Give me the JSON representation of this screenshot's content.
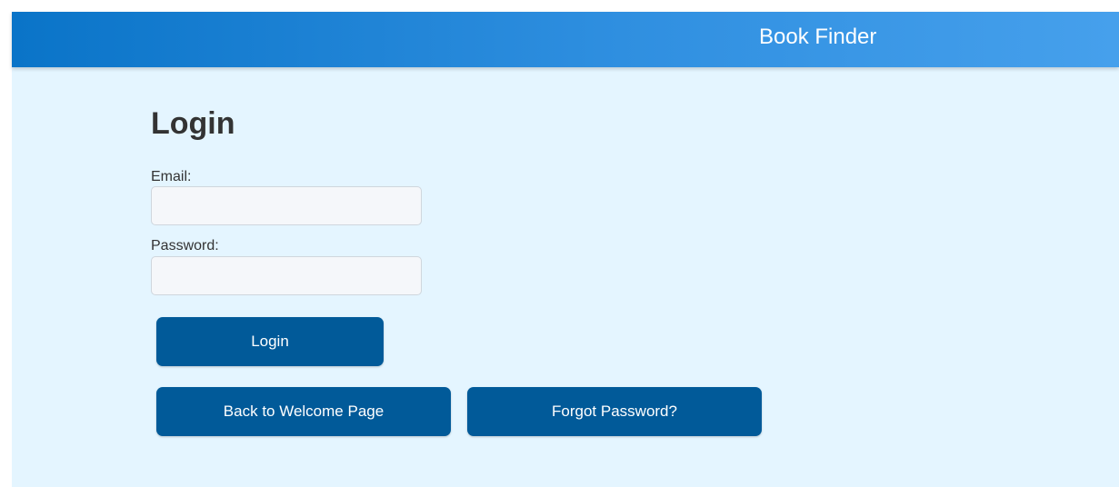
{
  "header": {
    "title": "Book Finder"
  },
  "login": {
    "title": "Login",
    "email_label": "Email:",
    "email_value": "",
    "password_label": "Password:",
    "password_value": "",
    "login_button": "Login",
    "back_button": "Back to Welcome Page",
    "forgot_button": "Forgot Password?"
  },
  "colors": {
    "header_start": "#0a74c8",
    "header_end": "#46a0ec",
    "page_background": "#e4f5ff",
    "button": "#015a99",
    "button_text": "#ffffff"
  }
}
